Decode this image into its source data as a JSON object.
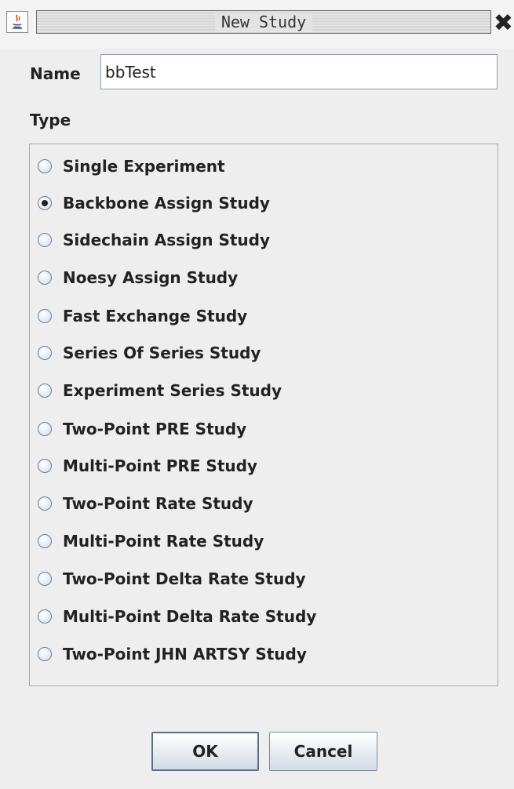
{
  "window": {
    "title": "New Study",
    "app_icon": "java-icon",
    "close_icon": "close-icon",
    "close_glyph": "✖"
  },
  "name_field": {
    "label": "Name",
    "value": "bbTest"
  },
  "type_group": {
    "label": "Type",
    "selected": "Backbone Assign Study",
    "options": [
      {
        "label": "Single Experiment",
        "checked": false
      },
      {
        "label": "Backbone Assign Study",
        "checked": true
      },
      {
        "label": "Sidechain Assign Study",
        "checked": false
      },
      {
        "label": "Noesy Assign Study",
        "checked": false
      },
      {
        "label": "Fast Exchange Study",
        "checked": false
      },
      {
        "label": "Series Of Series Study",
        "checked": false
      },
      {
        "label": "Experiment Series Study",
        "checked": false
      },
      {
        "label": "Two-Point PRE Study",
        "checked": false
      },
      {
        "label": "Multi-Point PRE Study",
        "checked": false
      },
      {
        "label": "Two-Point Rate Study",
        "checked": false
      },
      {
        "label": "Multi-Point Rate Study",
        "checked": false
      },
      {
        "label": "Two-Point Delta Rate Study",
        "checked": false
      },
      {
        "label": "Multi-Point Delta Rate Study",
        "checked": false
      },
      {
        "label": "Two-Point JHN ARTSY Study",
        "checked": false
      }
    ]
  },
  "buttons": {
    "ok_label": "OK",
    "cancel_label": "Cancel"
  },
  "colors": {
    "background": "#eeeeee",
    "input_border": "#8c9eb3",
    "panel_border": "#9aa9b9"
  }
}
